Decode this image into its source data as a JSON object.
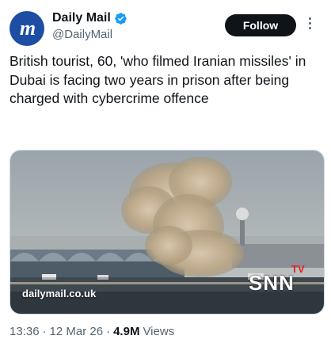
{
  "author": {
    "name": "Daily Mail",
    "handle": "@DailyMail",
    "avatar_letter": "m",
    "verified": true
  },
  "follow_label": "Follow",
  "tweet_text": "British tourist, 60, 'who filmed Iranian missiles' in Dubai is facing two years in prison after being charged with cybercrime offence",
  "media": {
    "watermark": "dailymail.co.uk",
    "channel_logo": "SNN",
    "channel_logo_sub": "TV"
  },
  "meta": {
    "time": "13:36",
    "date": "12 Mar 26",
    "views_count": "4.9M",
    "views_label": "Views"
  },
  "colors": {
    "verified": "#1d9bf0",
    "follow_bg": "#0f1419",
    "secondary_text": "#536471",
    "avatar_bg": "#1d4ea3"
  }
}
